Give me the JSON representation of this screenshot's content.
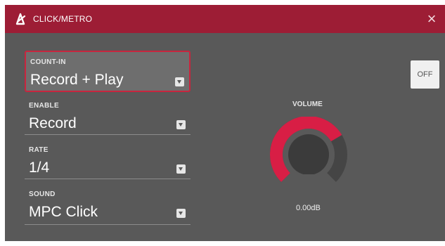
{
  "dialog": {
    "title": "CLICK/METRO",
    "close_icon": "close-icon",
    "title_icon": "metronome-icon"
  },
  "fields": {
    "count_in": {
      "label": "COUNT-IN",
      "value": "Record + Play"
    },
    "enable": {
      "label": "ENABLE",
      "value": "Record"
    },
    "rate": {
      "label": "RATE",
      "value": "1/4"
    },
    "sound": {
      "label": "SOUND",
      "value": "MPC Click"
    }
  },
  "toggle": {
    "label": "OFF"
  },
  "volume": {
    "label": "VOLUME",
    "value": "0.00dB",
    "level": 0.72,
    "colors": {
      "fill": "#d81e45",
      "track": "#454545",
      "knob": "#3b3b3b"
    }
  },
  "colors": {
    "accent": "#9d1d35",
    "background": "#595959"
  }
}
